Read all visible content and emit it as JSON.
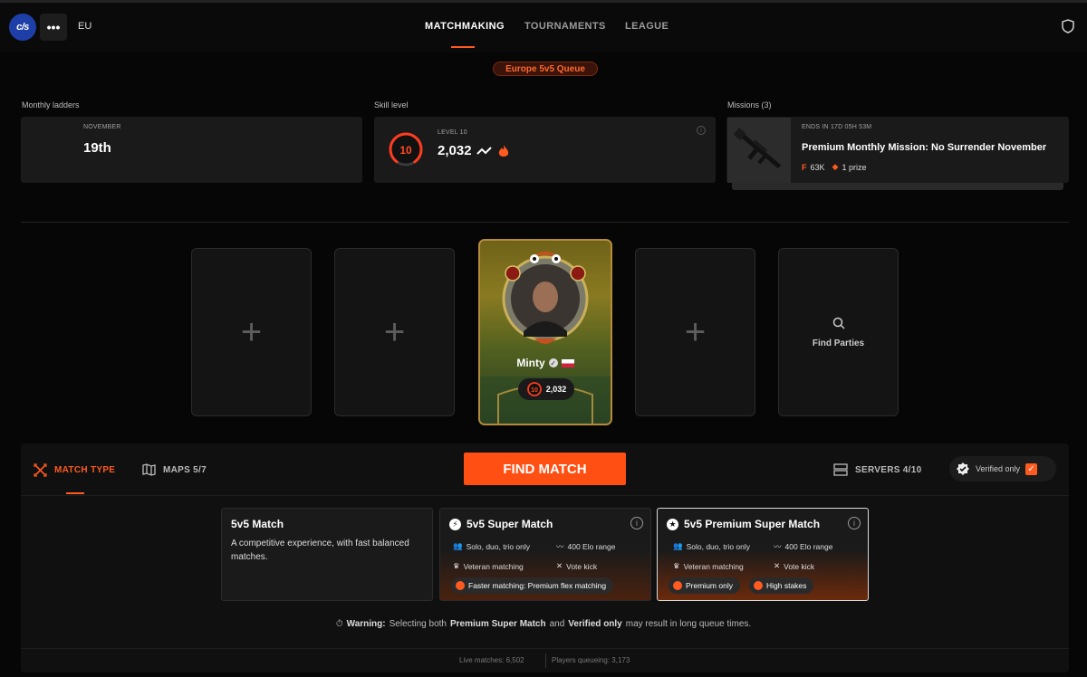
{
  "header": {
    "logo_text": "c/s",
    "more_label": "•••",
    "region": "EU",
    "nav": [
      "MATCHMAKING",
      "TOURNAMENTS",
      "LEAGUE"
    ],
    "active_nav": "MATCHMAKING"
  },
  "queue_badge": "Europe 5v5 Queue",
  "ladders": {
    "label": "Monthly ladders",
    "month": "NOVEMBER",
    "rank": "19th"
  },
  "skill": {
    "label": "Skill level",
    "level_caption": "LEVEL 10",
    "level": "10",
    "elo": "2,032",
    "level_progress": 0.8
  },
  "missions": {
    "label": "Missions (3)",
    "ends": "ENDS IN 17D 05H 53M",
    "title": "Premium Monthly Mission: No Surrender November",
    "reward_points": "63K",
    "reward_prize": "1 prize"
  },
  "party": {
    "find_parties": "Find Parties",
    "player": {
      "name": "Minty",
      "level": "10",
      "elo": "2,032"
    }
  },
  "toolbar": {
    "match_type": "MATCH TYPE",
    "maps": "MAPS 5/7",
    "find_match": "FIND MATCH",
    "servers": "SERVERS 4/10",
    "verified_only": "Verified only",
    "verified_checked": true
  },
  "match_types": {
    "standard": {
      "title": "5v5 Match",
      "desc": "A competitive experience, with fast balanced matches."
    },
    "super": {
      "title": "5v5 Super Match",
      "f1": "Solo, duo, trio only",
      "f2": "400 Elo range",
      "f3": "Veteran matching",
      "f4": "Vote kick",
      "pill": "Faster matching: Premium flex matching"
    },
    "premium": {
      "title": "5v5 Premium Super Match",
      "f1": "Solo, duo, trio only",
      "f2": "400 Elo range",
      "f3": "Veteran matching",
      "f4": "Vote kick",
      "pill1": "Premium only",
      "pill2": "High stakes"
    }
  },
  "warning": {
    "label": "Warning:",
    "text1": "Selecting both",
    "b1": "Premium Super Match",
    "text2": "and",
    "b2": "Verified only",
    "text3": "may result in long queue times."
  },
  "stats": {
    "live_label": "Live matches:",
    "live": "6,502",
    "queue_label": "Players queueing:",
    "queue": "3,173"
  },
  "colors": {
    "accent": "#ff5a1f",
    "logo": "#1e3fa8"
  }
}
